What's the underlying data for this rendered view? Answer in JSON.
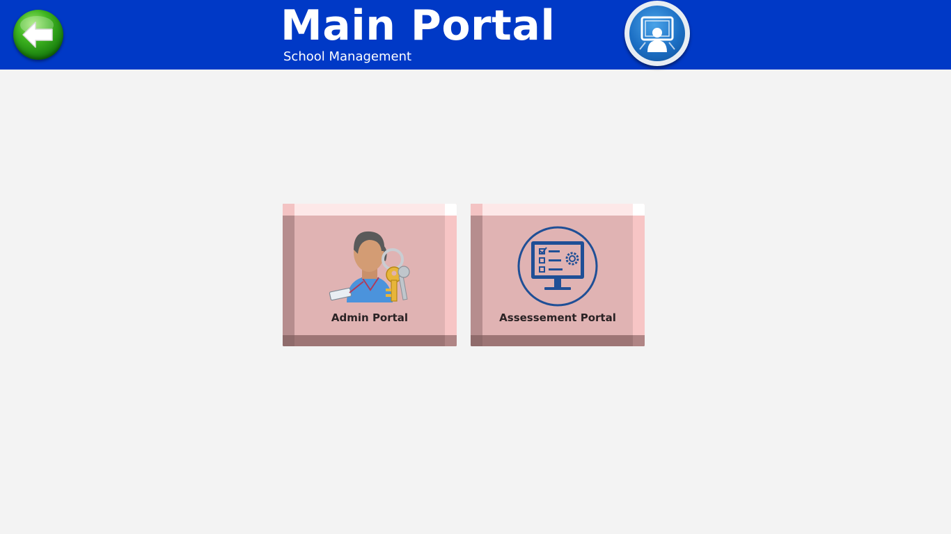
{
  "header": {
    "title": "Main Portal",
    "subtitle": "School Management",
    "background_color": "#0039c6",
    "back_button_icon": "back-arrow-icon",
    "user_button_icon": "computer-user-icon"
  },
  "tiles": [
    {
      "label": "Admin Portal",
      "icon": "admin-with-keys-icon"
    },
    {
      "label": "Assessement Portal",
      "icon": "monitor-checklist-gear-icon"
    }
  ],
  "colors": {
    "page_background": "#f3f3f3",
    "tile_face": "#e0b3b3",
    "tile_label": "#2a2224",
    "assessment_icon": "#1f4f96"
  }
}
